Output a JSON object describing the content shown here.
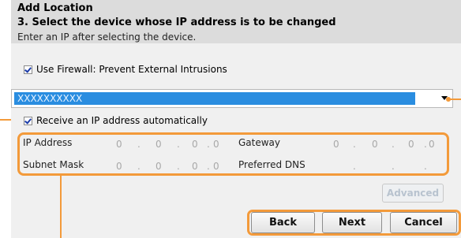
{
  "dialog": {
    "title": "Add Location",
    "step": "3. Select the device whose IP address is to be changed",
    "hint": "Enter an IP after selecting the device."
  },
  "firewall_checkbox": {
    "label": "Use Firewall: Prevent External Intrusions",
    "checked": true
  },
  "device_select": {
    "value": "XXXXXXXXXX"
  },
  "auto_ip_checkbox": {
    "label": "Receive an IP address automatically",
    "checked": true
  },
  "ip_fields": {
    "ip_address": {
      "label": "IP Address",
      "octets": [
        "0",
        "0",
        "0",
        "0"
      ]
    },
    "gateway": {
      "label": "Gateway",
      "octets": [
        "0",
        "0",
        "0",
        "0"
      ]
    },
    "subnet_mask": {
      "label": "Subnet Mask",
      "octets": [
        "0",
        "0",
        "0",
        "0"
      ]
    },
    "preferred_dns": {
      "label": "Preferred DNS",
      "octets": [
        "",
        "",
        "",
        ""
      ]
    },
    "separator": "."
  },
  "buttons": {
    "advanced": "Advanced",
    "back": "Back",
    "next": "Next",
    "cancel": "Cancel"
  },
  "colors": {
    "highlight": "#f39a3a",
    "selection": "#2a8de0"
  }
}
